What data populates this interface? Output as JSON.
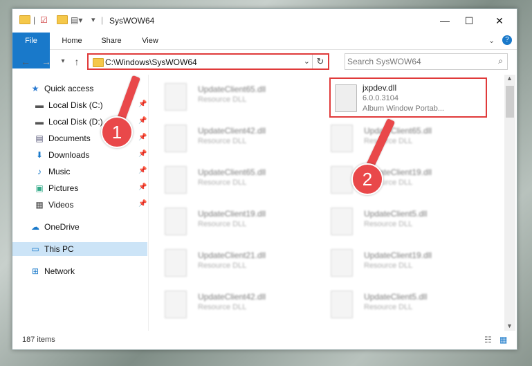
{
  "window": {
    "title": "SysWOW64"
  },
  "ribbon": {
    "tabs": [
      "File",
      "Home",
      "Share",
      "View"
    ]
  },
  "address": {
    "path": "C:\\Windows\\SysWOW64",
    "search_placeholder": "Search SysWOW64"
  },
  "nav": {
    "quick_access": "Quick access",
    "items": [
      {
        "label": "Local Disk (C:)",
        "icon": "drive-icon"
      },
      {
        "label": "Local Disk (D:)",
        "icon": "drive-icon"
      },
      {
        "label": "Documents",
        "icon": "documents-icon"
      },
      {
        "label": "Downloads",
        "icon": "download-icon"
      },
      {
        "label": "Music",
        "icon": "music-icon"
      },
      {
        "label": "Pictures",
        "icon": "pictures-icon"
      },
      {
        "label": "Videos",
        "icon": "videos-icon"
      }
    ],
    "onedrive": "OneDrive",
    "this_pc": "This PC",
    "network": "Network"
  },
  "files": {
    "highlight": {
      "name": "jxpdev.dll",
      "version": "6.0.0.3104",
      "desc": "Album Window Portab..."
    },
    "left": [
      {
        "name": "UpdateClient65.dll",
        "desc": "Resource DLL"
      },
      {
        "name": "UpdateClient42.dll",
        "desc": "Resource DLL"
      },
      {
        "name": "UpdateClient65.dll",
        "desc": "Resource DLL"
      },
      {
        "name": "UpdateClient19.dll",
        "desc": "Resource DLL"
      },
      {
        "name": "UpdateClient21.dll",
        "desc": "Resource DLL"
      },
      {
        "name": "UpdateClient42.dll",
        "desc": "Resource DLL"
      }
    ],
    "right": [
      {
        "name": "UpdateClient65.dll",
        "desc": "Resource DLL"
      },
      {
        "name": "UpdateClient19.dll",
        "desc": "Resource DLL"
      },
      {
        "name": "UpdateClient5.dll",
        "desc": "Resource DLL"
      },
      {
        "name": "UpdateClient19.dll",
        "desc": "Resource DLL"
      },
      {
        "name": "UpdateClient5.dll",
        "desc": "Resource DLL"
      }
    ]
  },
  "status": {
    "count": "187 items"
  },
  "annotations": {
    "step1": "1",
    "step2": "2"
  }
}
